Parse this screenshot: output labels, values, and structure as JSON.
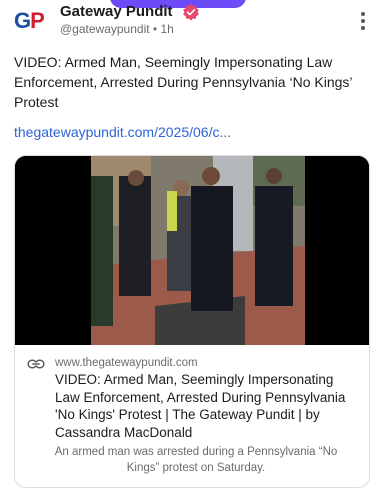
{
  "author": {
    "avatar_left": "G",
    "avatar_right": "P",
    "name": "Gateway Pundit",
    "handle": "@gatewaypundit",
    "separator": "•",
    "time": "1h"
  },
  "post": {
    "text": "VIDEO: Armed Man, Seemingly Impersonating Law Enforcement, Arrested During Pennsylvania ‘No Kings’ Protest",
    "link": "thegatewaypundit.com/2025/06/c..."
  },
  "card": {
    "image_icon": "video-frame",
    "domain": "www.thegatewaypundit.com",
    "title": "VIDEO: Armed Man, Seemingly Impersonating Law Enforcement, Arrested During Pennsylvania 'No Kings' Protest | The Gateway Pundit | by Cassandra MacDonald",
    "description": "An armed man was arrested during a Pennsylvania “No Kings” protest on Saturday."
  },
  "icons": {
    "verified": "verified-badge-icon",
    "more": "more-vertical-icon",
    "link": "link-icon"
  },
  "colors": {
    "verified": "#e8466b",
    "link": "#2f63d8",
    "brand_blue": "#1b4ea3",
    "brand_red": "#d0202f",
    "top_pill": "#6b4cf6"
  }
}
